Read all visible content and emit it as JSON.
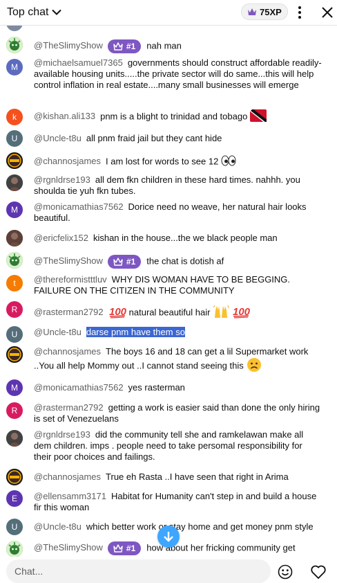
{
  "header": {
    "title": "Top chat",
    "xp": "75XP"
  },
  "colors": {
    "badge": "#7e57c2",
    "highlight": "#3b67d1",
    "scroll_button": "#3ea6ff",
    "author": "#606060"
  },
  "badge_label": "#1",
  "messages": [
    {
      "avatar_letter": "",
      "avatar_color": "#2e7d32",
      "avatar_icon": "slime-avatar",
      "author": "@TheSlimyShow",
      "badge": true,
      "text": "nah man"
    },
    {
      "avatar_letter": "M",
      "avatar_color": "#5c6bc0",
      "author": "@michaelsamuel7365",
      "badge": false,
      "text": "governments should construct affordable readily-available housing units.....the private sector will do same...this will help control inflation in real estate....many small businesses will emerge"
    },
    {
      "avatar_letter": "k",
      "avatar_color": "#f4511e",
      "author": "@kishan.ali133",
      "badge": false,
      "text": "pnm is a blight to trinidad and tobago",
      "emoji": "trinidad-flag-icon"
    },
    {
      "avatar_letter": "U",
      "avatar_color": "#546e7a",
      "author": "@Uncle-t8u",
      "badge": false,
      "text": "all pnm fraid jail but they cant hide"
    },
    {
      "avatar_letter": "",
      "avatar_color": "#3e2723",
      "avatar_icon": "logo-avatar",
      "author": "@channosjames",
      "badge": false,
      "text": "I am lost for words to see 12",
      "emoji": "eyes-icon"
    },
    {
      "avatar_letter": "",
      "avatar_color": "#424242",
      "avatar_icon": "photo-avatar",
      "author": "@rgnldrse193",
      "badge": false,
      "text": "all dem fkn children in these hard times. nahhh. you shoulda tie yuh fkn tubes."
    },
    {
      "avatar_letter": "M",
      "avatar_color": "#5e35b1",
      "author": "@monicamathias7562",
      "badge": false,
      "text": "Dorice need no weave, her natural hair looks beautiful."
    },
    {
      "avatar_letter": "",
      "avatar_color": "#5d4037",
      "avatar_icon": "photo-avatar",
      "author": "@ericfelix152",
      "badge": false,
      "text": "kishan in the house...the we black people man"
    },
    {
      "avatar_letter": "",
      "avatar_color": "#2e7d32",
      "avatar_icon": "slime-avatar",
      "author": "@TheSlimyShow",
      "badge": true,
      "text": "the chat is dotish af"
    },
    {
      "avatar_letter": "t",
      "avatar_color": "#f57c00",
      "author": "@thereformistttluv",
      "badge": false,
      "text": "WHY DIS WOMAN HAVE TO BE BEGGING. FAILURE ON THE CITIZEN IN THE COMMUNITY"
    },
    {
      "avatar_letter": "R",
      "avatar_color": "#d81b60",
      "author": "@rasterman2792",
      "badge": false,
      "text_parts": [
        "natural beautiful hair"
      ],
      "emoji_before": "hundred-icon",
      "emoji_after": [
        "raised-hands-icon",
        "hundred-icon"
      ]
    },
    {
      "avatar_letter": "U",
      "avatar_color": "#546e7a",
      "author": "@Uncle-t8u",
      "badge": false,
      "text": "darse pnm have them so",
      "highlighted": true
    },
    {
      "avatar_letter": "",
      "avatar_color": "#3e2723",
      "avatar_icon": "logo-avatar",
      "author": "@channosjames",
      "badge": false,
      "text": "The boys 16 and 18 can get a lil Supermarket work ..You all help Mommy out ..I cannot stand seeing this",
      "emoji": "frown-face-icon"
    },
    {
      "avatar_letter": "M",
      "avatar_color": "#5e35b1",
      "author": "@monicamathias7562",
      "badge": false,
      "text": "yes rasterman"
    },
    {
      "avatar_letter": "R",
      "avatar_color": "#d81b60",
      "author": "@rasterman2792",
      "badge": false,
      "text": "getting a work is easier said than done the only hiring is set of Venezuelans"
    },
    {
      "avatar_letter": "",
      "avatar_color": "#424242",
      "avatar_icon": "photo-avatar",
      "author": "@rgnldrse193",
      "badge": false,
      "text": "did the community tell she and ramkelawan make all dem children. imps . people need to take persomal responsibility for their poor choices and failings."
    },
    {
      "avatar_letter": "",
      "avatar_color": "#3e2723",
      "avatar_icon": "logo-avatar",
      "author": "@channosjames",
      "badge": false,
      "text": "True eh Rasta ..I have seen that right in Arima"
    },
    {
      "avatar_letter": "E",
      "avatar_color": "#5e35b1",
      "author": "@ellensamm3171",
      "badge": false,
      "text": "Habitat for Humanity can't step in and build a house fir this woman"
    },
    {
      "avatar_letter": "U",
      "avatar_color": "#546e7a",
      "author": "@Uncle-t8u",
      "badge": false,
      "text": "which better work or stay home and get money pnm style"
    },
    {
      "avatar_letter": "",
      "avatar_color": "#2e7d32",
      "avatar_icon": "slime-avatar",
      "author": "@TheSlimyShow",
      "badge": true,
      "text": "how about her fricking community get"
    }
  ],
  "footer": {
    "placeholder": "Chat..."
  }
}
